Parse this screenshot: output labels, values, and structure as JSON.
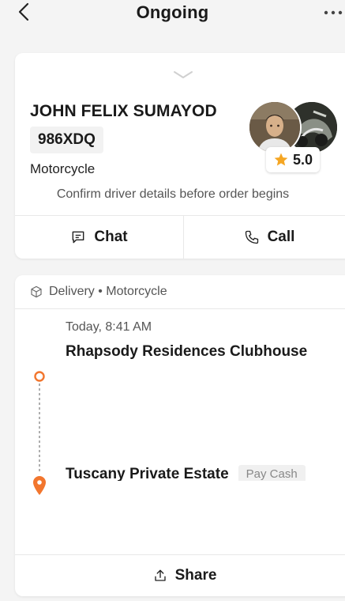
{
  "header": {
    "title": "Ongoing",
    "back_icon": "chevron-left-icon",
    "more_icon": "more-horizontal-icon"
  },
  "driver": {
    "name": "JOHN FELIX SUMAYOD",
    "plate": "986XDQ",
    "vehicle": "Motorcycle",
    "rating": "5.0",
    "confirm_text": "Confirm driver details before order begins",
    "chat_label": "Chat",
    "call_label": "Call"
  },
  "delivery": {
    "service": "Delivery • Motorcycle",
    "timestamp": "Today, 8:41 AM",
    "pickup": "Rhapsody Residences Clubhouse",
    "dropoff": "Tuscany Private Estate",
    "payment": "Pay Cash",
    "share_label": "Share"
  },
  "colors": {
    "accent": "#f2762e",
    "star": "#f5a623",
    "text": "#1a1a1a",
    "muted": "#555555"
  }
}
